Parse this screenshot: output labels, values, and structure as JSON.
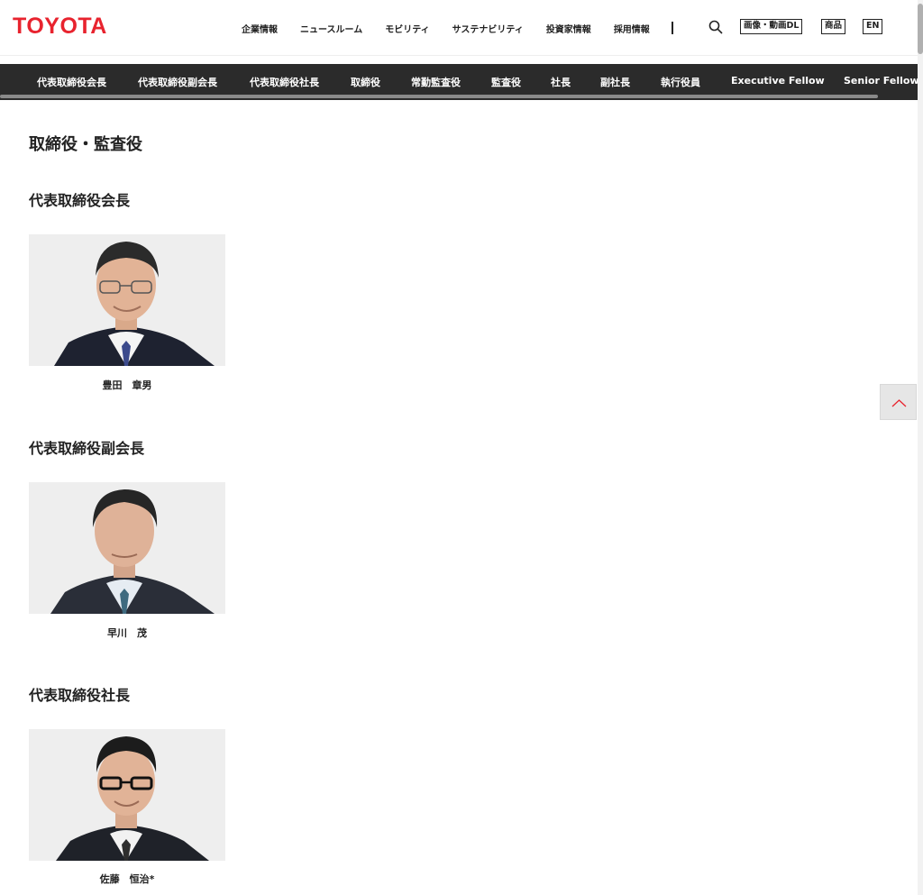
{
  "header": {
    "logo": "TOYOTA",
    "nav": [
      "企業情報",
      "ニュースルーム",
      "モビリティ",
      "サステナビリティ",
      "投資家情報",
      "採用情報"
    ],
    "buttons": {
      "media_dl": "画像・動画DL",
      "products": "商品",
      "lang": "EN"
    }
  },
  "subnav": {
    "items": [
      "代表取締役会長",
      "代表取締役副会長",
      "代表取締役社長",
      "取締役",
      "常勤監査役",
      "監査役",
      "社長",
      "副社長",
      "執行役員",
      "Executive Fellow",
      "Senior Fellow"
    ]
  },
  "page": {
    "title": "取締役・監査役",
    "sections": [
      {
        "title": "代表取締役会長",
        "name": "豊田　章男"
      },
      {
        "title": "代表取締役副会長",
        "name": "早川　茂"
      },
      {
        "title": "代表取締役社長",
        "name": "佐藤　恒治*"
      }
    ]
  },
  "colors": {
    "brand": "#e8232e",
    "subnav_bg": "#2b2b2b",
    "photo_bg": "#eeeeee"
  },
  "icons": {
    "search": "search-icon",
    "back_to_top": "chevron-up-icon"
  }
}
